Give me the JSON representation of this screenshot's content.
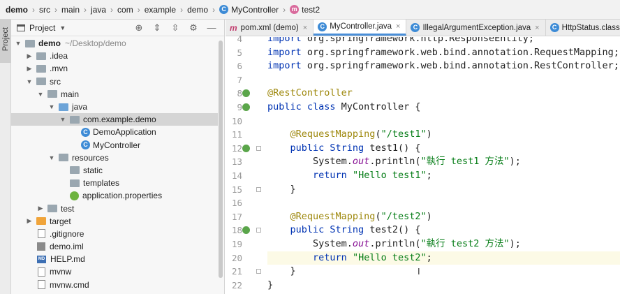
{
  "breadcrumb": [
    {
      "label": "demo",
      "bold": true
    },
    {
      "label": "src"
    },
    {
      "label": "main"
    },
    {
      "label": "java"
    },
    {
      "label": "com"
    },
    {
      "label": "example"
    },
    {
      "label": "demo"
    },
    {
      "label": "MyController",
      "icon": "C"
    },
    {
      "label": "test2",
      "icon": "m"
    }
  ],
  "stripe": {
    "project_label": "Project"
  },
  "project_panel": {
    "title": "Project"
  },
  "tree": [
    {
      "label": "demo",
      "hint": "~/Desktop/demo",
      "bold": true
    },
    {
      "label": ".idea"
    },
    {
      "label": ".mvn"
    },
    {
      "label": "src"
    },
    {
      "label": "main"
    },
    {
      "label": "java"
    },
    {
      "label": "com.example.demo"
    },
    {
      "label": "DemoApplication"
    },
    {
      "label": "MyController"
    },
    {
      "label": "resources"
    },
    {
      "label": "static"
    },
    {
      "label": "templates"
    },
    {
      "label": "application.properties"
    },
    {
      "label": "test"
    },
    {
      "label": "target"
    },
    {
      "label": ".gitignore"
    },
    {
      "label": "demo.iml"
    },
    {
      "label": "HELP.md"
    },
    {
      "label": "mvnw"
    },
    {
      "label": "mvnw.cmd"
    }
  ],
  "tabs": [
    {
      "label": "pom.xml (demo)",
      "icon": "m"
    },
    {
      "label": "MyController.java",
      "icon": "C",
      "active": true
    },
    {
      "label": "IllegalArgumentException.java",
      "icon": "C"
    },
    {
      "label": "HttpStatus.class",
      "icon": "C"
    }
  ],
  "code": {
    "line_numbers": [
      "4",
      "5",
      "6",
      "7",
      "8",
      "9",
      "10",
      "11",
      "12",
      "13",
      "14",
      "15",
      "16",
      "17",
      "18",
      "19",
      "20",
      "21",
      "22"
    ],
    "lines": [
      "import org.springframework.http.ResponseEntity;",
      "import org.springframework.web.bind.annotation.RequestMapping;",
      "import org.springframework.web.bind.annotation.RestController;",
      "",
      "@RestController",
      "public class MyController {",
      "",
      "    @RequestMapping(\"/test1\")",
      "    public String test1() {",
      "        System.out.println(\"執行 test1 方法\");",
      "        return \"Hello test1\";",
      "    }",
      "",
      "    @RequestMapping(\"/test2\")",
      "    public String test2() {",
      "        System.out.println(\"執行 test2 方法\");",
      "        return \"Hello test2\";",
      "    }",
      "}"
    ]
  },
  "colors": {
    "accent": "#4a8fd8",
    "keyword": "#0033b3",
    "annotation": "#9e880d",
    "string": "#067d17"
  }
}
